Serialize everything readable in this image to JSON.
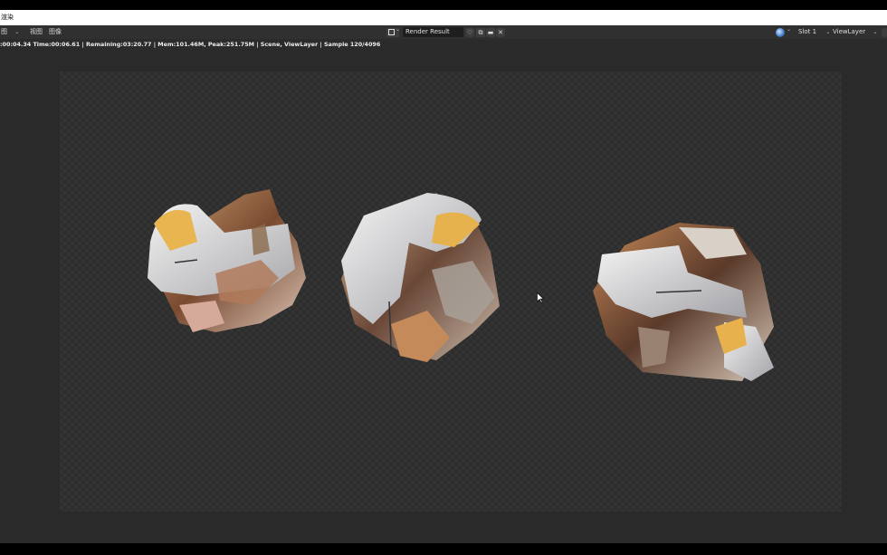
{
  "window": {
    "title": "渲染"
  },
  "header": {
    "editor_menu": "图",
    "menus": [
      "视图",
      "图像"
    ],
    "image_name": "Render Result",
    "slot": "Slot 1",
    "view_layer": "ViewLayer",
    "pin_icon": "pin-icon"
  },
  "status": {
    "text": ":00:04.34 Time:00:06.61 | Remaining:03:20.77 | Mem:101.46M, Peak:251.75M | Scene, ViewLayer | Sample 120/4096"
  },
  "colors": {
    "header_bg": "#303030",
    "viewport_bg": "#2a2a2a",
    "checker_light": "#333333",
    "checker_dark": "#2d2d2d"
  }
}
